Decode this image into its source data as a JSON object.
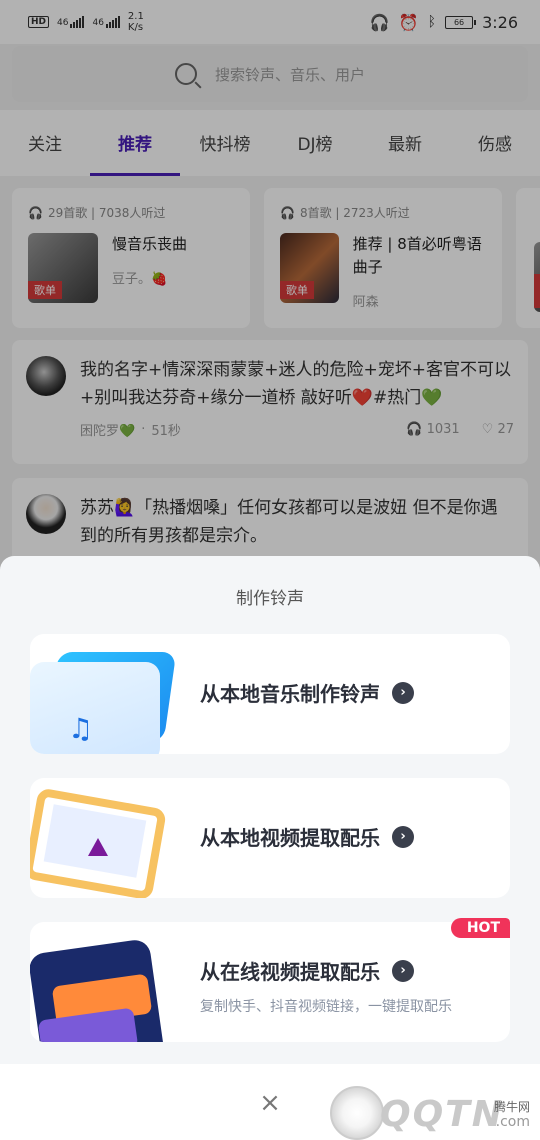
{
  "status_bar": {
    "hd": "HD",
    "net_speed": "2.1",
    "net_unit": "K/s",
    "sig1": "46",
    "sig2": "46",
    "battery": "66",
    "time": "3:26"
  },
  "search": {
    "placeholder": "搜索铃声、音乐、用户"
  },
  "tabs": [
    {
      "label": "关注"
    },
    {
      "label": "推荐",
      "active": true
    },
    {
      "label": "快抖榜"
    },
    {
      "label": "DJ榜"
    },
    {
      "label": "最新"
    },
    {
      "label": "伤感"
    }
  ],
  "playlists": [
    {
      "meta": "29首歌 | 7038人听过",
      "title": "慢音乐丧曲",
      "author": "豆子。🍓",
      "tag": "歌单"
    },
    {
      "meta": "8首歌 | 2723人听过",
      "title": "推荐 | 8首必听粤语曲子",
      "author": "阿森",
      "tag": "歌单"
    },
    {
      "tag": "歌单"
    }
  ],
  "posts": [
    {
      "text": "我的名字+情深深雨蒙蒙+迷人的危险+宠坏+客官不可以+别叫我达芬奇+缘分一道桥 敲好听❤️#热门💚",
      "author": "困陀罗💚",
      "duration": "51秒",
      "plays": "1031",
      "likes": "27"
    },
    {
      "text": "苏苏🙋‍♀️「热播烟嗓」任何女孩都可以是波妞 但不是你遇到的所有男孩都是宗介。"
    }
  ],
  "sheet": {
    "title": "制作铃声",
    "options": [
      {
        "label": "从本地音乐制作铃声",
        "icon": "music-folder-icon"
      },
      {
        "label": "从本地视频提取配乐",
        "icon": "video-frame-icon"
      },
      {
        "label": "从在线视频提取配乐",
        "sub": "复制快手、抖音视频链接，一键提取配乐",
        "badge": "HOT",
        "icon": "online-video-icon"
      }
    ],
    "close": "×"
  },
  "watermark": {
    "text": "QQTN",
    "small": "腾牛网",
    "domain": ".com"
  }
}
